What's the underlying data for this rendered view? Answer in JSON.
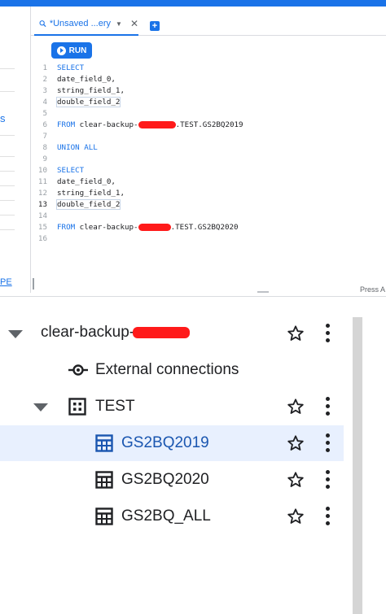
{
  "editor_tab": {
    "label": "*Unsaved ...ery",
    "close_glyph": "✕"
  },
  "add_tab_glyph": "+",
  "run_button": {
    "label": "RUN"
  },
  "left_partial": {
    "s": "s",
    "pe": "PE"
  },
  "code_lines": [
    {
      "n": "1",
      "text": "SELECT",
      "kw": true
    },
    {
      "n": "2",
      "text": "date_field_0,"
    },
    {
      "n": "3",
      "text": "string_field_1,"
    },
    {
      "n": "4",
      "text": "double_field_2",
      "boxed": true
    },
    {
      "n": "5",
      "text": ""
    },
    {
      "n": "6",
      "text": "FROM clear-backup-",
      "kw_prefix": "FROM",
      "suffix": ".TEST.GS2BQ2019",
      "redacted": true
    },
    {
      "n": "7",
      "text": ""
    },
    {
      "n": "8",
      "text": "UNION ALL",
      "kw": true
    },
    {
      "n": "9",
      "text": ""
    },
    {
      "n": "10",
      "text": "SELECT",
      "kw": true
    },
    {
      "n": "11",
      "text": "date_field_0,"
    },
    {
      "n": "12",
      "text": "string_field_1,"
    },
    {
      "n": "13",
      "text": "double_field_2",
      "boxed": true,
      "active": true
    },
    {
      "n": "14",
      "text": ""
    },
    {
      "n": "15",
      "text": "FROM clear-backup-",
      "kw_prefix": "FROM",
      "suffix": ".TEST.GS2BQ2020",
      "redacted": true
    },
    {
      "n": "16",
      "text": ""
    }
  ],
  "press_hint": "Press A",
  "tree": {
    "project": {
      "label": "clear-backup-"
    },
    "external_connections": {
      "label": "External connections"
    },
    "dataset": {
      "label": "TEST"
    },
    "tables": [
      {
        "label": "GS2BQ2019",
        "selected": true
      },
      {
        "label": "GS2BQ2020",
        "selected": false
      },
      {
        "label": "GS2BQ_ALL",
        "selected": false
      }
    ]
  },
  "colors": {
    "accent": "#1a73e8",
    "selected_row": "#e8f0fe",
    "redaction": "#ff1a1a"
  }
}
